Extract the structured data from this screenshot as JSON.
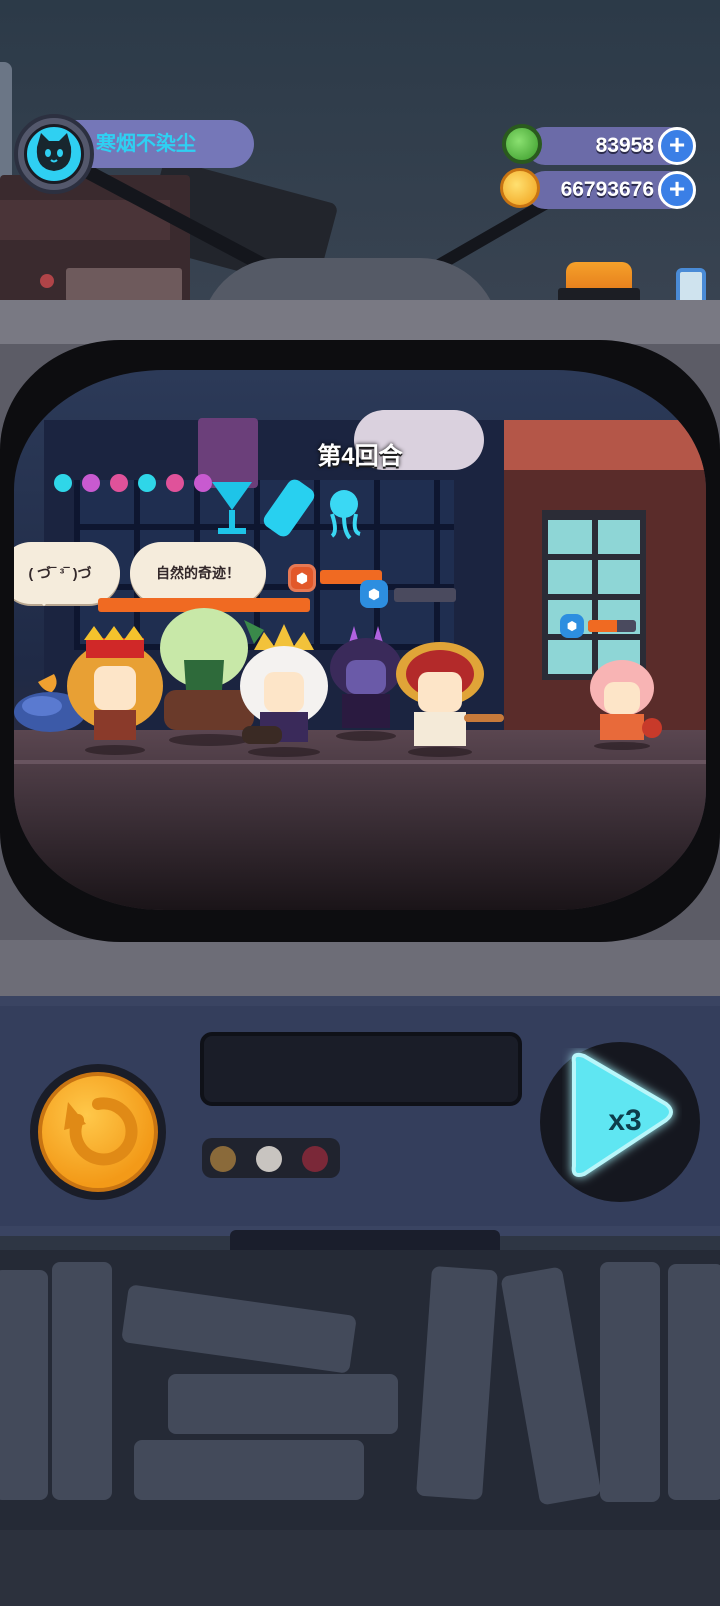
{
  "player": {
    "name": "寒烟不染尘",
    "avatar_icon": "cat-avatar-icon"
  },
  "resources": [
    {
      "icon": "green-gem-icon",
      "value": "83958",
      "color": "#4bbf3a"
    },
    {
      "icon": "gold-coin-icon",
      "value": "66793676",
      "color": "#f7b21e"
    }
  ],
  "battle": {
    "round_label": "第4回合",
    "speech_bubbles": [
      {
        "text": "( づ‾ ³‾ )づ"
      },
      {
        "text": "自然的奇迹！"
      }
    ],
    "allies": [
      {
        "name": "blue-slime"
      },
      {
        "name": "lion-king"
      },
      {
        "name": "tree-spirit"
      },
      {
        "name": "white-queen"
      },
      {
        "name": "shadow-mage"
      },
      {
        "name": "laurel-warrior"
      }
    ],
    "enemies": [
      {
        "name": "pink-girl"
      }
    ],
    "health": [
      {
        "id": "ally-front",
        "fraction": 0.7,
        "shield": "hex-orange"
      },
      {
        "id": "ally-mid",
        "fraction": 0.0,
        "shield": "hex-blue"
      },
      {
        "id": "enemy",
        "fraction": 0.6,
        "shield": "hex-blue"
      }
    ]
  },
  "controls": {
    "undo_icon": "restart-arrow-icon",
    "speed_label": "x3",
    "speed_icon": "play-fast-icon",
    "element_dots": [
      "#8a6a3a",
      "#c8c4c0",
      "#7a2838"
    ]
  },
  "colors": {
    "accent_cyan": "#2fd0f2",
    "hp_orange": "#f06a22",
    "plus_blue": "#3a7fe6"
  }
}
